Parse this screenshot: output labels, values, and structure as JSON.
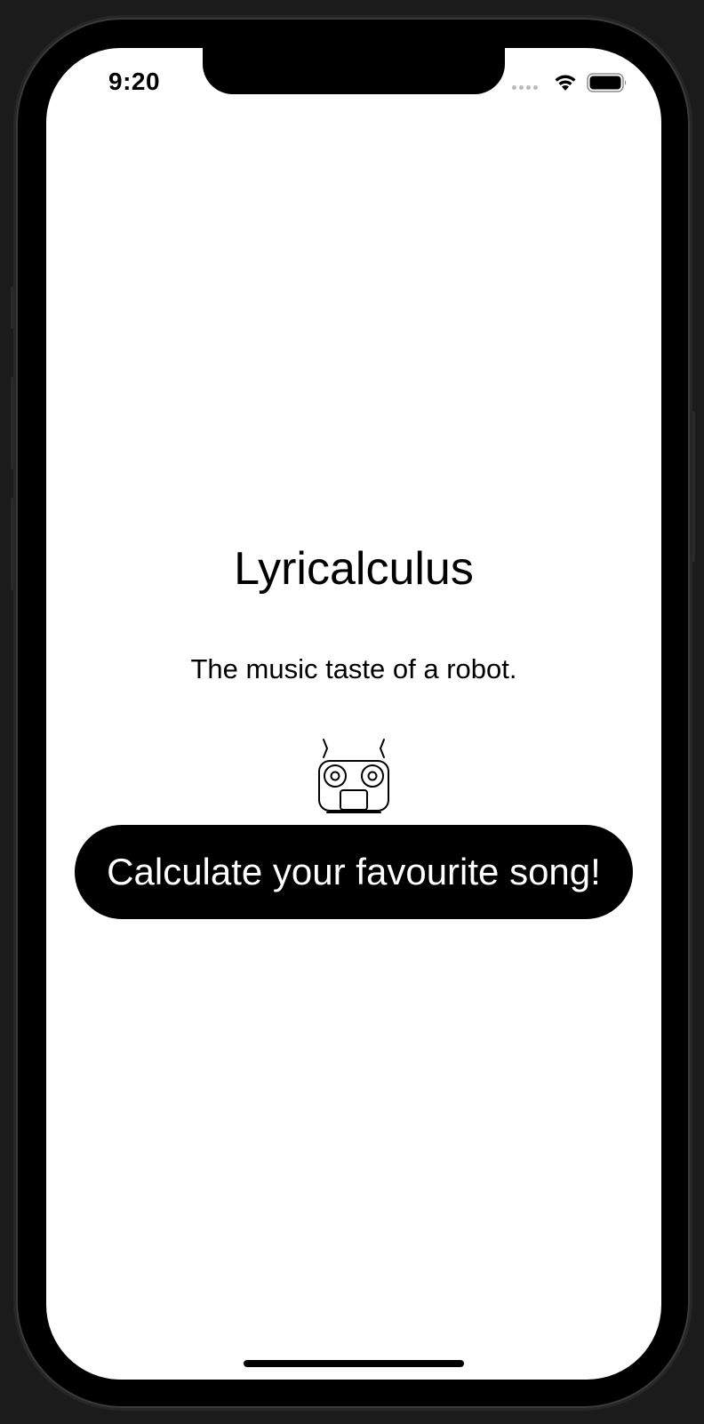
{
  "status_bar": {
    "time": "9:20",
    "icons": [
      "cellular-signal-icon",
      "wifi-icon",
      "battery-icon"
    ]
  },
  "main": {
    "title": "Lyricalculus",
    "subtitle": "The music taste of a robot.",
    "illustration_icon": "robot-icon",
    "cta_label": "Calculate your favourite song!"
  },
  "colors": {
    "background": "#ffffff",
    "text": "#000000",
    "button_background": "#000000",
    "button_text": "#ffffff",
    "device_frame": "#000000"
  }
}
